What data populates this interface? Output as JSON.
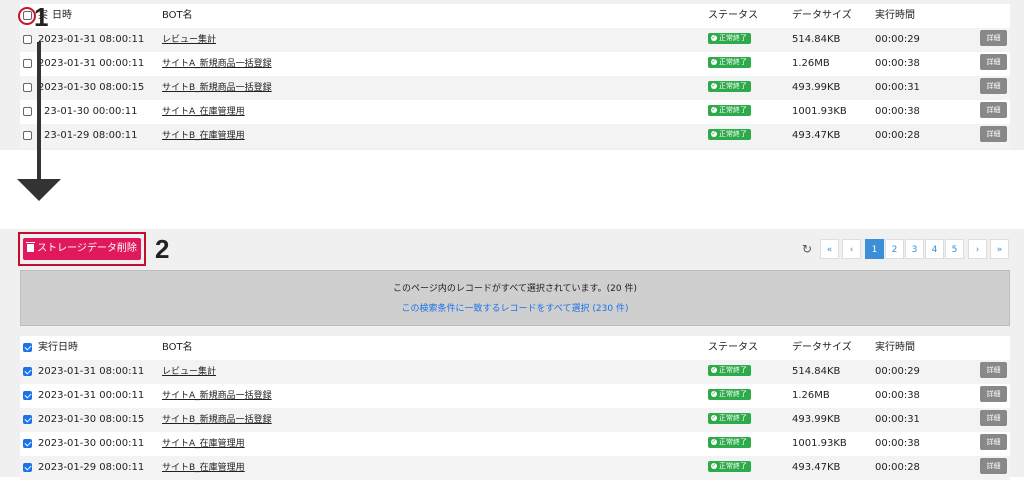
{
  "columns": {
    "date": "実行日時",
    "bot": "BOT名",
    "status": "ステータス",
    "size": "データサイズ",
    "time": "実行時間"
  },
  "top_header_date_visible": "実",
  "top_header_date_rest": "日時",
  "rows": [
    {
      "date": "2023-01-31 08:00:11",
      "bot": "レビュー集計",
      "status": "正常終了",
      "size": "514.84KB",
      "time": "00:00:29",
      "detail": "詳細"
    },
    {
      "date": "2023-01-31 00:00:11",
      "bot": "サイトA_新規商品一括登録",
      "status": "正常終了",
      "size": "1.26MB",
      "time": "00:00:38",
      "detail": "詳細"
    },
    {
      "date": "2023-01-30 08:00:15",
      "bot": "サイトB_新規商品一括登録",
      "status": "正常終了",
      "size": "493.99KB",
      "time": "00:00:31",
      "detail": "詳細"
    },
    {
      "date": "2023-01-30 00:00:11",
      "bot": "サイトA_在庫管理用",
      "status": "正常終了",
      "size": "1001.93KB",
      "time": "00:00:38",
      "detail": "詳細"
    },
    {
      "date": "2023-01-29 08:00:11",
      "bot": "サイトB_在庫管理用",
      "status": "正常終了",
      "size": "493.47KB",
      "time": "00:00:28",
      "detail": "詳細"
    }
  ],
  "top_rows_partial_dates": [
    "2023-01-31 08:00:11",
    "2023-01-31 00:00:11",
    "2023-01-30 08:00:15",
    "23-01-30 00:00:11",
    "23-01-29 08:00:11"
  ],
  "annotations": {
    "step1": "1",
    "step2": "2"
  },
  "toolbar": {
    "delete_label": "ストレージデータ削除"
  },
  "pagination": {
    "first": "«",
    "prev": "‹",
    "pages": [
      "1",
      "2",
      "3",
      "4",
      "5"
    ],
    "current": "1",
    "next": "›",
    "last": "»"
  },
  "selection_notice": {
    "all_on_page": "このページ内のレコードがすべて選択されています。(20 件)",
    "select_all_link": "この検索条件に一致するレコードをすべて選択 (230 件)"
  },
  "colors": {
    "status_green": "#2eaa4a",
    "delete_pink": "#e0185c",
    "highlight_red": "#c40e2c",
    "link_blue": "#1a73e8"
  }
}
